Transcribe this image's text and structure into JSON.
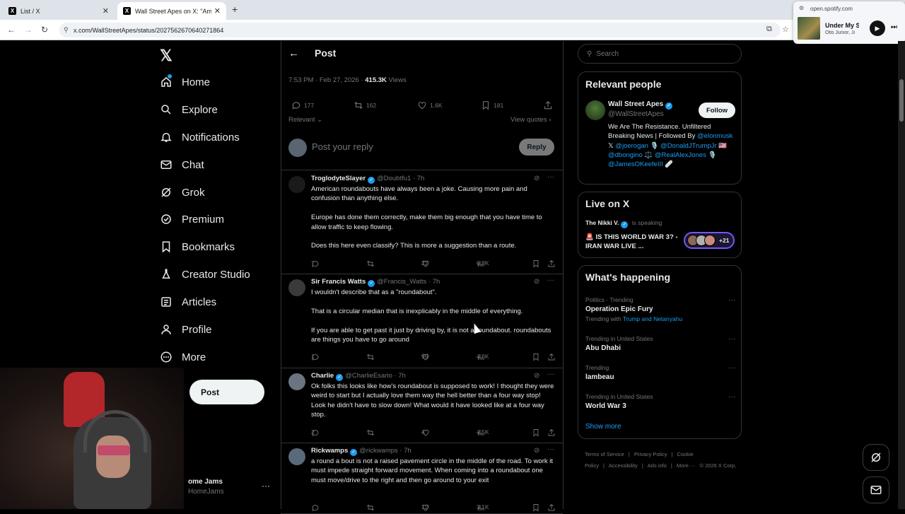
{
  "browser": {
    "tabs": [
      {
        "label": "List / X",
        "active": false
      },
      {
        "label": "Wall Street Apes on X: \"America...",
        "active": true
      }
    ],
    "url": "x.com/WallStreetApes/status/2027562670640271864",
    "media_popup": {
      "domain": "open.spotify.com",
      "song": "Under My S",
      "artist": "Otis Junior, Ji"
    }
  },
  "nav": {
    "items": [
      {
        "label": "Home",
        "icon": "home-icon"
      },
      {
        "label": "Explore",
        "icon": "search-icon"
      },
      {
        "label": "Notifications",
        "icon": "bell-icon"
      },
      {
        "label": "Chat",
        "icon": "envelope-icon"
      },
      {
        "label": "Grok",
        "icon": "grok-icon"
      },
      {
        "label": "Premium",
        "icon": "premium-icon"
      },
      {
        "label": "Bookmarks",
        "icon": "bookmark-icon"
      },
      {
        "label": "Creator Studio",
        "icon": "flask-icon"
      },
      {
        "label": "Articles",
        "icon": "article-icon"
      },
      {
        "label": "Profile",
        "icon": "person-icon"
      },
      {
        "label": "More",
        "icon": "more-circle-icon"
      }
    ],
    "post_button": "Post",
    "account": {
      "name": "ome Jams",
      "handle": "HomeJams"
    }
  },
  "main": {
    "header_title": "Post",
    "timestamp": "7:53 PM · Feb 27, 2026 · ",
    "views_count": "415.3K",
    "views_label": " Views",
    "stats": {
      "replies": "177",
      "reposts": "162",
      "likes": "1.6K",
      "bookmarks": "181"
    },
    "sort_label": "Relevant",
    "view_quotes": "View quotes",
    "reply_placeholder": "Post your reply",
    "reply_button": "Reply",
    "replies": [
      {
        "name": "TroglodyteSlayer",
        "handle": "@Doubtfu1 · 7h",
        "paragraphs": [
          "American roundabouts have always been a joke. Causing more pain and confusion than anything else.",
          "Europe has done them correctly, make them big enough that you have time to allow traffic to keep flowing.",
          "Does this here even classify? This is more a suggestion than a route."
        ],
        "replies": "7",
        "reposts": "",
        "likes": "22",
        "views": "6.8K"
      },
      {
        "name": "Sir Francis Watts",
        "handle": "@Francis_Watts · 7h",
        "paragraphs": [
          "I wouldn't describe that as a \"roundabout\".",
          "That is a circular median that is inexplicably in the middle of everything.",
          "If you are able to get past it just by driving by, it is not a roundabout. roundabouts are things you have to go around"
        ],
        "replies": "1",
        "reposts": "",
        "likes": "99",
        "views": "4.6K"
      },
      {
        "name": "Charlie",
        "handle": "@CharlieEsario · 7h",
        "paragraphs": [
          "Ok folks this looks like how's roundabout is supposed to work! I thought they were weird to start but I actually love them way the hell better than a four way stop! Look he didn't have to slow down! What would it have looked like at a four way stop."
        ],
        "replies": "2",
        "reposts": "",
        "likes": "4",
        "views": "4.5K"
      },
      {
        "name": "Rickwamps",
        "handle": "@rickwamps · 7h",
        "paragraphs": [
          "a round a bout is not a raised pavement circle in the middle of the road.  To work it must impede straight forward movement.  When coming into a roundabout one must move/drive to the right and then go around to your exit"
        ],
        "replies": "",
        "reposts": "",
        "likes": "12",
        "views": "3.1K"
      }
    ]
  },
  "sidebar": {
    "search_placeholder": "Search",
    "relevant_people": {
      "title": "Relevant people",
      "name": "Wall Street Apes",
      "handle": "@WallStreetApes",
      "follow": "Follow",
      "bio_text": "We Are The Resistance. Unfiltered Breaking News | Followed By",
      "mentions": [
        "@elonmusk",
        "𝕏",
        "@joerogan",
        "🎙️",
        "@DonaldJTrumpJr",
        "🇺🇸",
        "@dbongino",
        "⚖️",
        "@RealAlexJones",
        "🎙️",
        "@JamesOKeefeIII",
        "🩹"
      ]
    },
    "live": {
      "title": "Live on X",
      "host": "The Nikki V.",
      "status": " is speaking",
      "space_title": "🚨 IS THIS WORLD WAR 3? - IRAN WAR LIVE ...",
      "listener_count": "+21"
    },
    "happening": {
      "title": "What's happening",
      "trends": [
        {
          "context": "Politics · Trending",
          "title": "Operation Epic Fury",
          "with_prefix": "Trending with ",
          "with": "Trump and Netanyahu"
        },
        {
          "context": "Trending in United States",
          "title": "Abu Dhabi"
        },
        {
          "context": "Trending",
          "title": "lambeau"
        },
        {
          "context": "Trending in United States",
          "title": "World War 3"
        }
      ],
      "show_more": "Show more"
    },
    "footer": [
      "Terms of Service",
      "|",
      "Privacy Policy",
      "|",
      "Cookie Policy",
      "|",
      "Accessibility",
      "|",
      "Ads info",
      "|",
      "More ···",
      "© 2026 X Corp."
    ]
  },
  "colors": {
    "accent": "#1d9bf0",
    "background": "#000000",
    "border": "#2f3336",
    "muted": "#71767b"
  }
}
